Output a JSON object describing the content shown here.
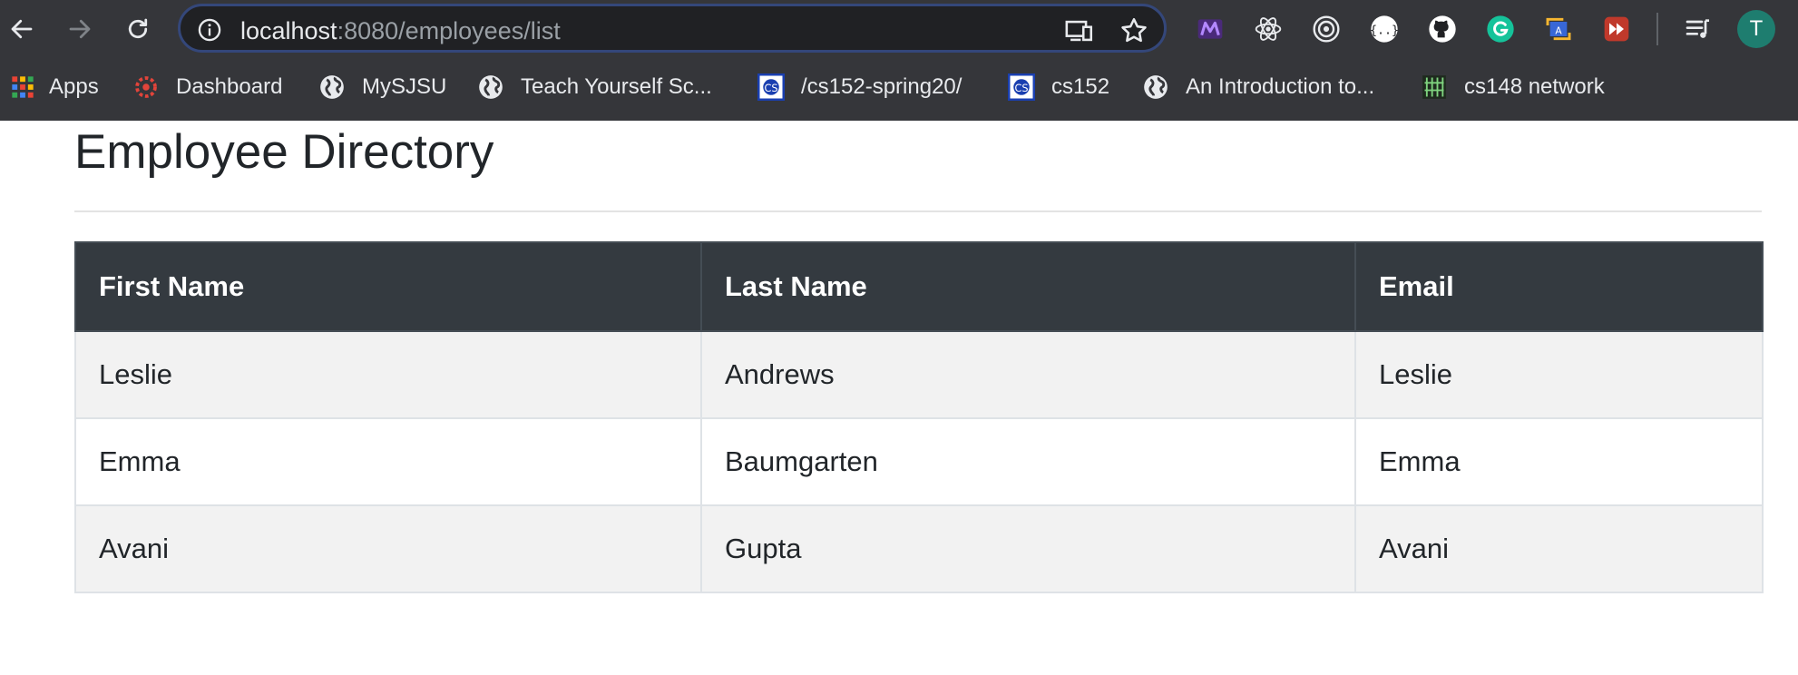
{
  "browser": {
    "url_host": "localhost",
    "url_path": ":8080/employees/list",
    "profile_initial": "T",
    "bookmarks": [
      {
        "label": "Apps",
        "icon": "apps-grid-icon"
      },
      {
        "label": "Dashboard",
        "icon": "canvas-icon"
      },
      {
        "label": "MySJSU",
        "icon": "globe-icon"
      },
      {
        "label": "Teach Yourself Sc...",
        "icon": "globe-icon"
      },
      {
        "label": "/cs152-spring20/",
        "icon": "cs-logo-icon"
      },
      {
        "label": "cs152",
        "icon": "cs-logo-icon"
      },
      {
        "label": "An Introduction to...",
        "icon": "globe-icon"
      },
      {
        "label": "cs148 network",
        "icon": "network-icon"
      }
    ],
    "extensions": [
      "m-logo-icon",
      "react-icon",
      "target-icon",
      "json-icon",
      "github-icon",
      "grammarly-icon",
      "translate-icon",
      "forward-icon"
    ],
    "colors": {
      "toolbar": "#35363a",
      "omnibox": "#202124",
      "avatar": "#1e7d6f"
    }
  },
  "page": {
    "title": "Employee Directory",
    "table": {
      "columns": [
        "First Name",
        "Last Name",
        "Email"
      ],
      "rows": [
        [
          "Leslie",
          "Andrews",
          "Leslie"
        ],
        [
          "Emma",
          "Baumgarten",
          "Emma"
        ],
        [
          "Avani",
          "Gupta",
          "Avani"
        ]
      ]
    },
    "colors": {
      "header_bg": "#343a40",
      "header_text": "#ffffff",
      "stripe": "#f2f2f2",
      "text": "#212529"
    }
  }
}
